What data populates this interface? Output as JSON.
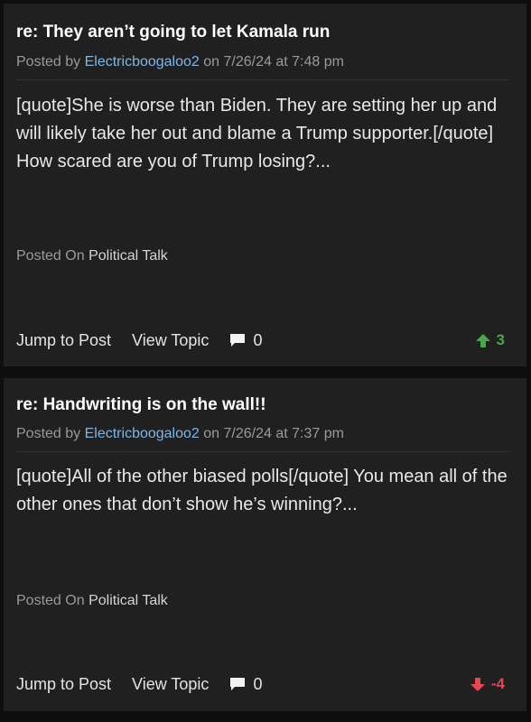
{
  "posts": [
    {
      "title": "re: They aren’t going to let Kamala run",
      "posted_by_prefix": "Posted by",
      "author": "Electricboogaloo2",
      "date_text": "on 7/26/24 at 7:48 pm",
      "body": "[quote]She is worse than Biden. They are setting her up and will likely take her out and blame a Trump supporter.[/quote] How scared are you of Trump losing?...",
      "posted_on_label": "Posted On",
      "forum": "Political Talk",
      "jump_label": "Jump to Post",
      "view_label": "View Topic",
      "comment_count": "0",
      "vote_direction": "up",
      "vote_value": "3",
      "vote_color": "#47a84a"
    },
    {
      "title": "re: Handwriting is on the wall!!",
      "posted_by_prefix": "Posted by",
      "author": "Electricboogaloo2",
      "date_text": "on 7/26/24 at 7:37 pm",
      "body": "[quote]All of the other biased polls[/quote] You mean all of the other ones that don’t show he’s winning?...",
      "posted_on_label": "Posted On",
      "forum": "Political Talk",
      "jump_label": "Jump to Post",
      "view_label": "View Topic",
      "comment_count": "0",
      "vote_direction": "down",
      "vote_value": "-4",
      "vote_color": "#e5484d"
    }
  ],
  "icons": {
    "comment": "comment-bubble-icon",
    "upvote": "arrow-up-icon",
    "downvote": "arrow-down-icon"
  },
  "colors": {
    "page_bg": "#0e0e0e",
    "card_bg": "#202020",
    "author_link": "#7fb6e6"
  }
}
